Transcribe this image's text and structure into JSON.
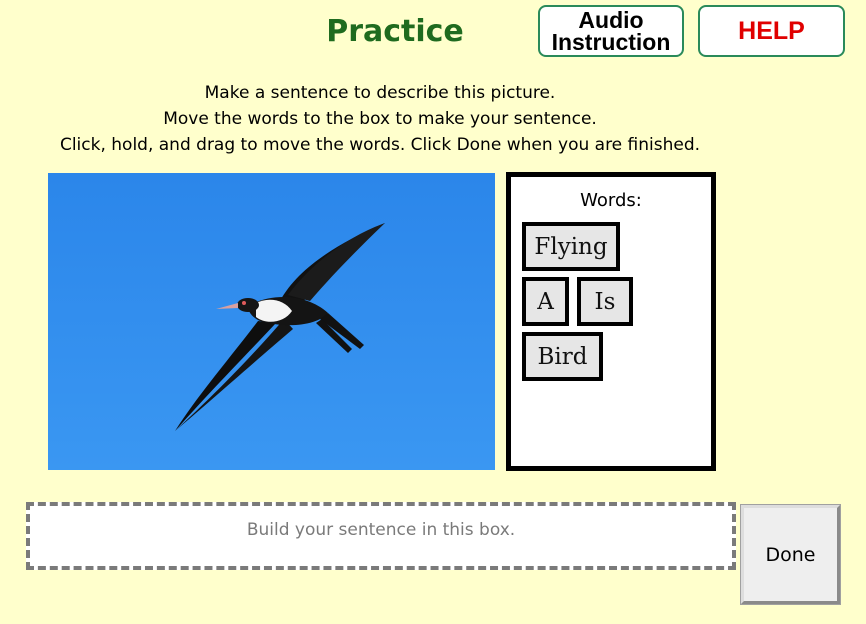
{
  "header": {
    "title": "Practice",
    "audio_button": {
      "line1": "Audio",
      "line2": "Instruction"
    },
    "help_button": "HELP"
  },
  "colors": {
    "background": "#ffffcc",
    "title": "#1f6b1f",
    "help_text": "#e00000",
    "button_border": "#2a8a5a",
    "sky": "#2f8ff0"
  },
  "instructions": [
    "Make a sentence to describe this picture.",
    "Move the words to the box to make your sentence.",
    "Click, hold, and drag to move the words. Click Done when you are finished."
  ],
  "words_panel": {
    "label": "Words:",
    "words": [
      "Flying",
      "A",
      "Is",
      "Bird"
    ]
  },
  "sentence_box": {
    "placeholder": "Build your sentence in this box."
  },
  "done_button": "Done"
}
